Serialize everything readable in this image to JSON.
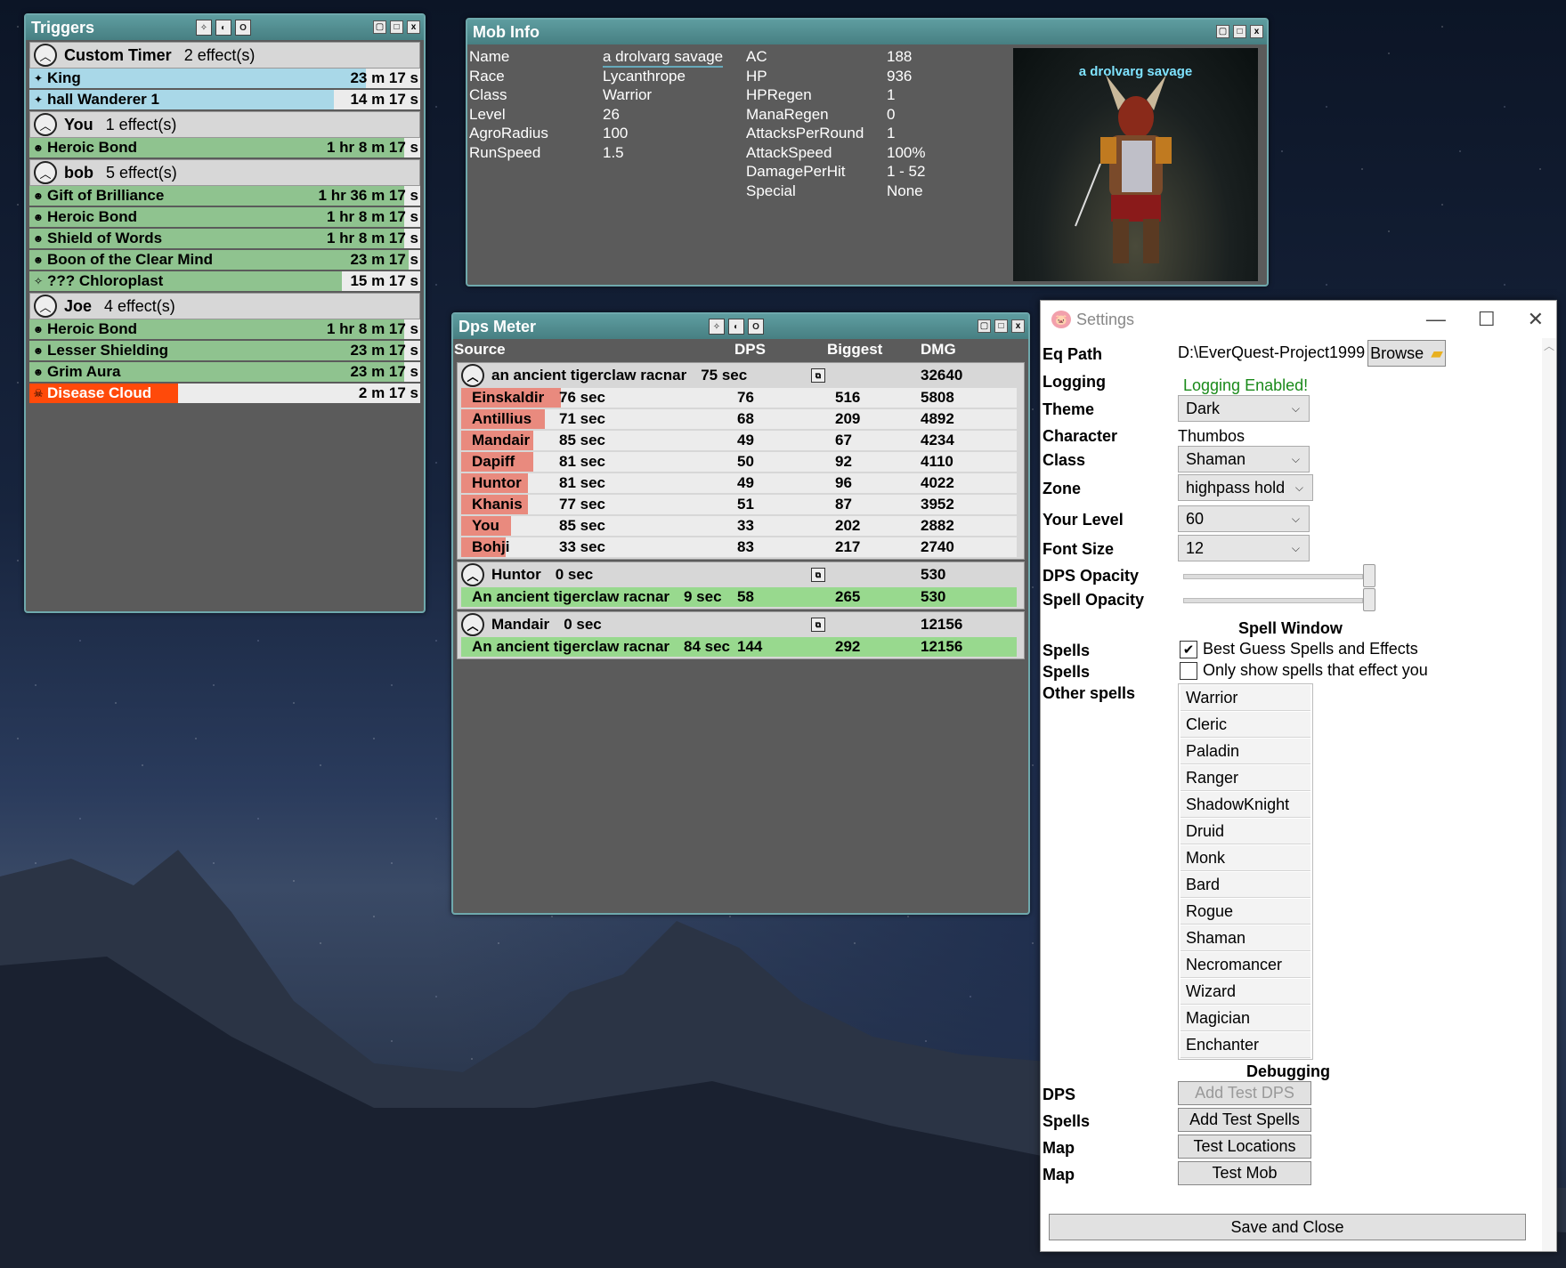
{
  "triggers": {
    "title": "Triggers",
    "groups": [
      {
        "name": "Custom Timer",
        "count": "2 effect(s)",
        "rows": [
          {
            "icon": "✦",
            "name": "King",
            "time": "23 m 17 s",
            "fill": "#a9d8e8",
            "pct": 0.86
          },
          {
            "icon": "✦",
            "name": "hall Wanderer 1",
            "time": "14 m 17 s",
            "fill": "#a9d8e8",
            "pct": 0.78
          }
        ]
      },
      {
        "name": "You",
        "count": "1 effect(s)",
        "rows": [
          {
            "icon": "☻",
            "name": "Heroic Bond",
            "time": "1 hr 8 m 17 s",
            "fill": "#8fc38f",
            "pct": 0.96
          }
        ]
      },
      {
        "name": "bob",
        "count": "5 effect(s)",
        "rows": [
          {
            "icon": "☻",
            "name": "Gift of Brilliance",
            "time": "1 hr 36 m 17 s",
            "fill": "#8fc38f",
            "pct": 0.96
          },
          {
            "icon": "☻",
            "name": "Heroic Bond",
            "time": "1 hr 8 m 17 s",
            "fill": "#8fc38f",
            "pct": 0.96
          },
          {
            "icon": "☻",
            "name": "Shield of Words",
            "time": "1 hr 8 m 17 s",
            "fill": "#8fc38f",
            "pct": 0.96
          },
          {
            "icon": "☻",
            "name": "Boon of the Clear Mind",
            "time": "23 m 17 s",
            "fill": "#8fc38f",
            "pct": 0.97
          },
          {
            "icon": "✧",
            "name": "??? Chloroplast",
            "time": "15 m 17 s",
            "fill": "#8fc38f",
            "pct": 0.8
          }
        ]
      },
      {
        "name": "Joe",
        "count": "4 effect(s)",
        "rows": [
          {
            "icon": "☻",
            "name": "Heroic Bond",
            "time": "1 hr 8 m 17 s",
            "fill": "#8fc38f",
            "pct": 0.96
          },
          {
            "icon": "☻",
            "name": "Lesser Shielding",
            "time": "23 m 17 s",
            "fill": "#8fc38f",
            "pct": 0.96
          },
          {
            "icon": "☻",
            "name": "Grim Aura",
            "time": "23 m 17 s",
            "fill": "#8fc38f",
            "pct": 0.96
          },
          {
            "icon": "☠",
            "name": "Disease Cloud",
            "time": "2 m 17 s",
            "fill": "#ff4a0a",
            "pct": 0.38
          }
        ]
      }
    ]
  },
  "mob": {
    "title": "Mob Info",
    "left": [
      [
        "Name",
        "a drolvarg savage"
      ],
      [
        "Race",
        "Lycanthrope"
      ],
      [
        "Class",
        "Warrior"
      ],
      [
        "Level",
        "26"
      ],
      [
        "AgroRadius",
        "100"
      ],
      [
        "RunSpeed",
        "1.5"
      ]
    ],
    "right": [
      [
        "AC",
        "188"
      ],
      [
        "HP",
        "936"
      ],
      [
        "HPRegen",
        "1"
      ],
      [
        "ManaRegen",
        "0"
      ],
      [
        "AttacksPerRound",
        "1"
      ],
      [
        "AttackSpeed",
        "100%"
      ],
      [
        "DamagePerHit",
        "1   - 52"
      ],
      [
        "Special",
        "None"
      ]
    ],
    "image_caption": "a drolvarg savage"
  },
  "dps": {
    "title": "Dps Meter",
    "headers": {
      "source": "Source",
      "dps": "DPS",
      "biggest": "Biggest",
      "dmg": "DMG"
    },
    "groups": [
      {
        "name": "an ancient tigerclaw racnar",
        "time": "75 sec",
        "dmg": "32640",
        "rows": [
          {
            "name": "Einskaldir",
            "time": "76 sec",
            "dps": "76",
            "big": "516",
            "dmg": "5808",
            "pct": 0.18
          },
          {
            "name": "Antillius",
            "time": "71 sec",
            "dps": "68",
            "big": "209",
            "dmg": "4892",
            "pct": 0.15
          },
          {
            "name": "Mandair",
            "time": "85 sec",
            "dps": "49",
            "big": "67",
            "dmg": "4234",
            "pct": 0.13
          },
          {
            "name": "Dapiff",
            "time": "81 sec",
            "dps": "50",
            "big": "92",
            "dmg": "4110",
            "pct": 0.13
          },
          {
            "name": "Huntor",
            "time": "81 sec",
            "dps": "49",
            "big": "96",
            "dmg": "4022",
            "pct": 0.12
          },
          {
            "name": "Khanis",
            "time": "77 sec",
            "dps": "51",
            "big": "87",
            "dmg": "3952",
            "pct": 0.12
          },
          {
            "name": "You",
            "time": "85 sec",
            "dps": "33",
            "big": "202",
            "dmg": "2882",
            "pct": 0.09
          },
          {
            "name": "Bohji",
            "time": "33 sec",
            "dps": "83",
            "big": "217",
            "dmg": "2740",
            "pct": 0.08
          }
        ],
        "fill": "#e98a7e"
      },
      {
        "name": "Huntor",
        "time": "0 sec",
        "dmg": "530",
        "rows": [
          {
            "name": "An ancient tigerclaw racnar",
            "time": "9 sec",
            "dps": "58",
            "big": "265",
            "dmg": "530",
            "pct": 1.0
          }
        ],
        "fill": "#98d98e"
      },
      {
        "name": "Mandair",
        "time": "0 sec",
        "dmg": "12156",
        "rows": [
          {
            "name": "An ancient tigerclaw racnar",
            "time": "84 sec",
            "dps": "144",
            "big": "292",
            "dmg": "12156",
            "pct": 1.0
          }
        ],
        "fill": "#98d98e"
      }
    ]
  },
  "settings": {
    "title": "Settings",
    "eq_path_label": "Eq Path",
    "eq_path": "D:\\EverQuest-Project1999",
    "browse": "Browse",
    "logging_label": "Logging",
    "logging_status": "Logging Enabled!",
    "theme_label": "Theme",
    "theme": "Dark",
    "character_label": "Character",
    "character": "Thumbos",
    "class_label": "Class",
    "class": "Shaman",
    "zone_label": "Zone",
    "zone": "highpass hold",
    "level_label": "Your Level",
    "level": "60",
    "font_label": "Font Size",
    "font": "12",
    "dps_opacity_label": "DPS Opacity",
    "spell_opacity_label": "Spell Opacity",
    "spell_window_header": "Spell Window",
    "spells_label": "Spells",
    "spells_label2": "Spells",
    "best_guess": "Best Guess Spells and Effects",
    "only_show": "Only show spells that effect you",
    "other_spells_label": "Other spells",
    "classes": [
      "Warrior",
      "Cleric",
      "Paladin",
      "Ranger",
      "ShadowKnight",
      "Druid",
      "Monk",
      "Bard",
      "Rogue",
      "Shaman",
      "Necromancer",
      "Wizard",
      "Magician",
      "Enchanter"
    ],
    "debugging_header": "Debugging",
    "dbg_dps_label": "DPS",
    "dbg_spells_label": "Spells",
    "dbg_map_label": "Map",
    "dbg_map_label2": "Map",
    "add_test_dps": "Add Test DPS",
    "add_test_spells": "Add Test Spells",
    "test_locations": "Test Locations",
    "test_mob": "Test Mob",
    "save_close": "Save and Close",
    "accent_green": "#1a8a1a"
  }
}
